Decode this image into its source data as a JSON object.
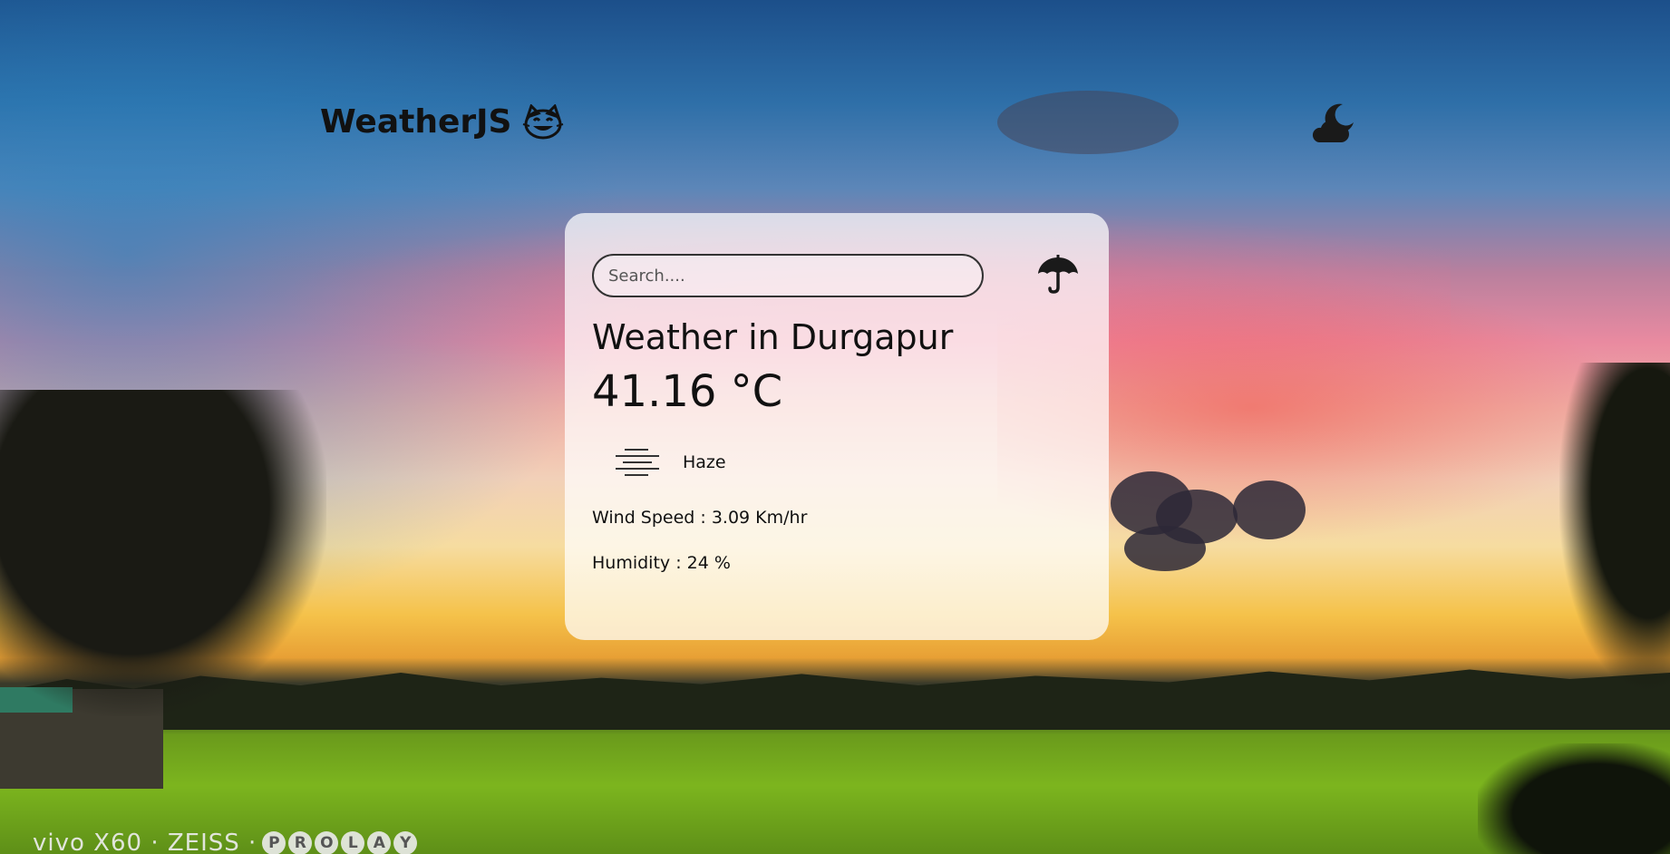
{
  "app": {
    "brand_name": "WeatherJS",
    "brand_icon": "smiling-cat-emoji-icon",
    "theme_toggle_icon": "cloud-moon-icon"
  },
  "search": {
    "placeholder": "Search....",
    "value": "",
    "button_icon": "umbrella-icon"
  },
  "weather": {
    "title": "Weather in Durgapur",
    "temperature": "41.16 °C",
    "condition_icon": "haze-icon",
    "condition": "Haze",
    "wind_speed": "Wind Speed : 3.09 Km/hr",
    "humidity": "Humidity : 24 %"
  },
  "watermark": {
    "text": "vivo X60 · ZEISS ·",
    "letters": [
      "P",
      "R",
      "O",
      "L",
      "A",
      "Y"
    ]
  },
  "colors": {
    "text": "#111111",
    "card_background": "rgba(255,255,255,0.72)",
    "input_border": "#333333"
  }
}
